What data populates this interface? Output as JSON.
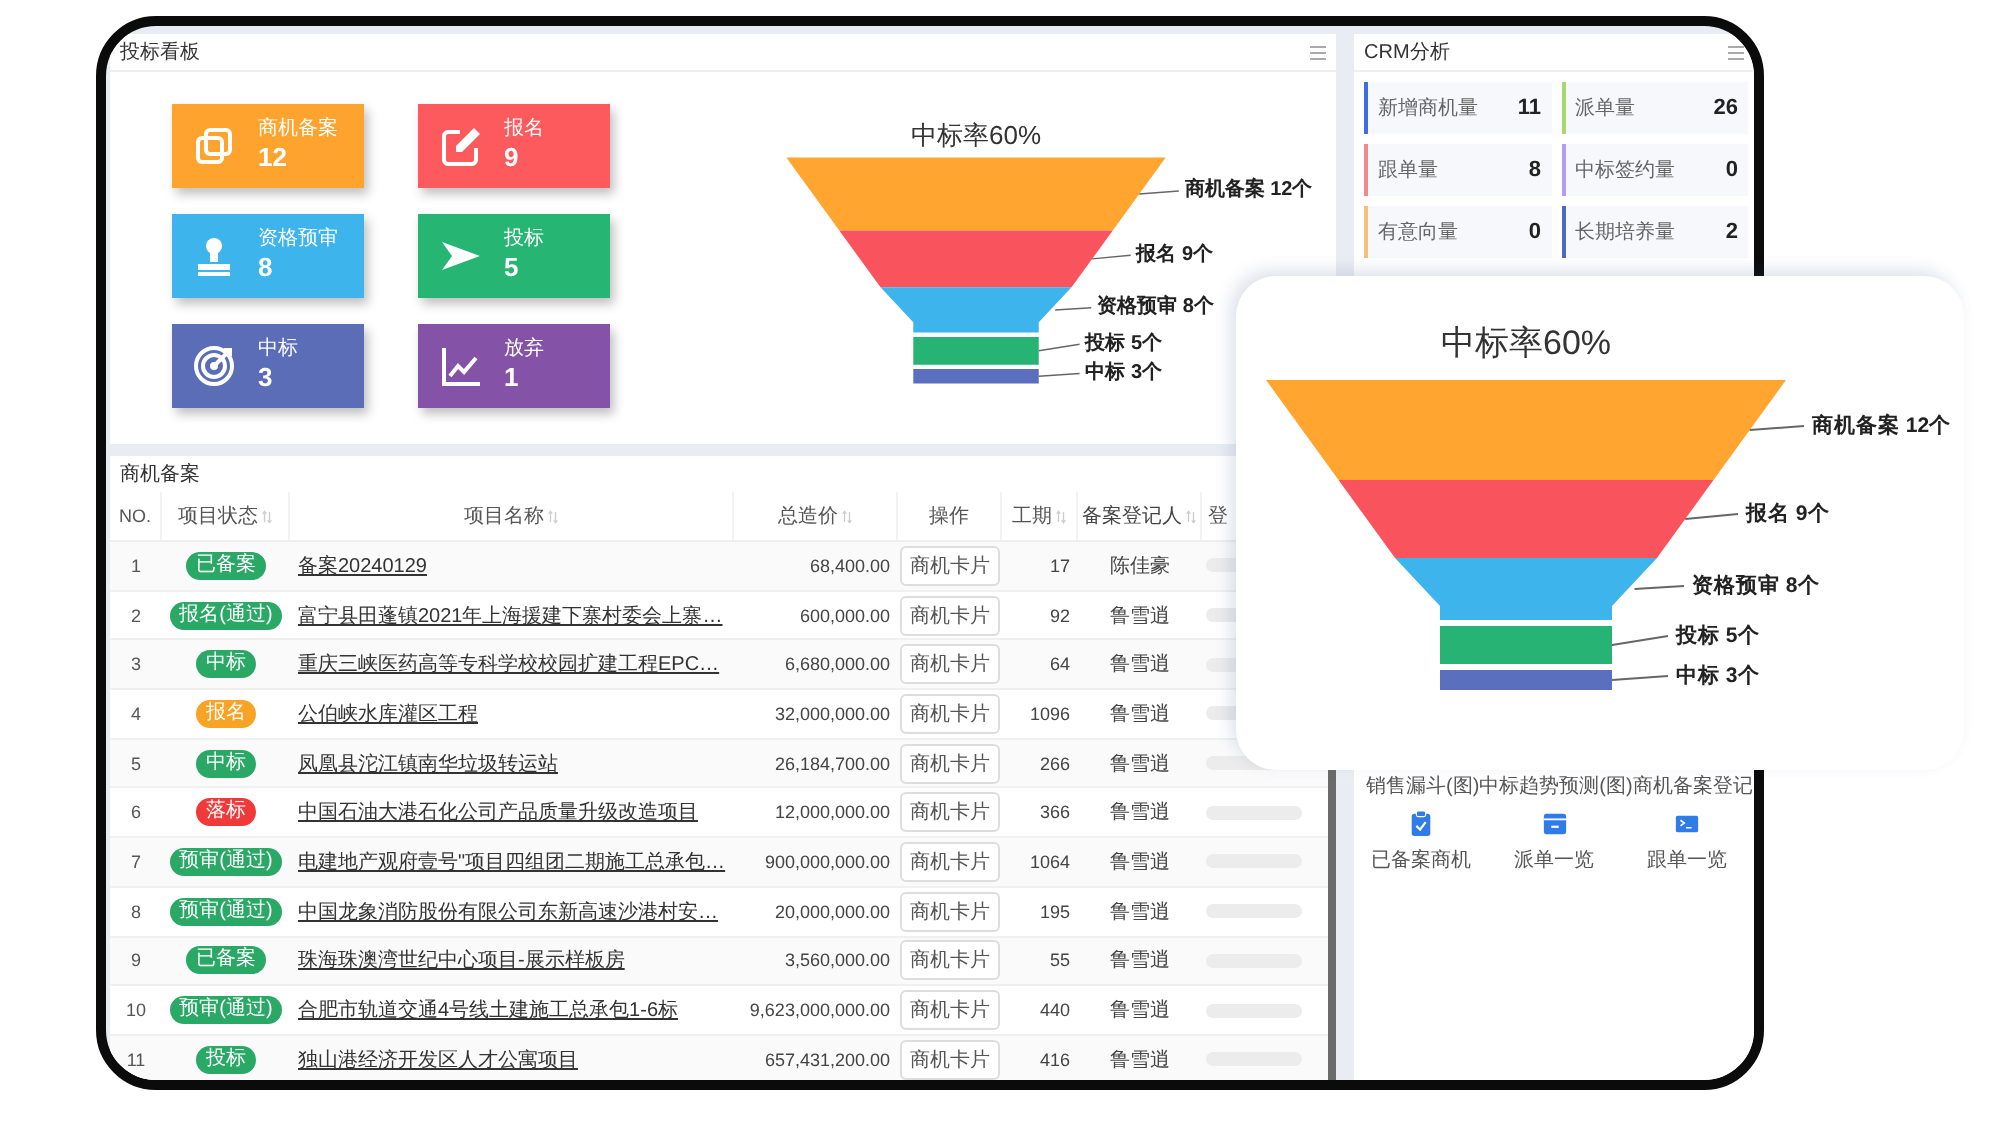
{
  "dashboard": {
    "title": "投标看板",
    "stats": [
      {
        "label": "商机备案",
        "value": "12",
        "color": "#fea42e"
      },
      {
        "label": "报名",
        "value": "9",
        "color": "#fc5a5d"
      },
      {
        "label": "资格预审",
        "value": "8",
        "color": "#3eb4ec"
      },
      {
        "label": "投标",
        "value": "5",
        "color": "#27b574"
      },
      {
        "label": "中标",
        "value": "3",
        "color": "#5a6db6"
      },
      {
        "label": "放弃",
        "value": "1",
        "color": "#8453a8"
      }
    ],
    "funnel": {
      "title": "中标率60%",
      "stages": [
        {
          "label": "商机备案 12个",
          "color": "#ffa530"
        },
        {
          "label": "报名 9个",
          "color": "#f9545e"
        },
        {
          "label": "资格预审 8个",
          "color": "#3db5ec"
        },
        {
          "label": "投标 5个",
          "color": "#27b373"
        },
        {
          "label": "中标 3个",
          "color": "#5b6fbf"
        }
      ]
    }
  },
  "table_panel": {
    "title": "商机备案",
    "columns": [
      {
        "label": "NO.",
        "sortable": false
      },
      {
        "label": "项目状态",
        "sortable": true
      },
      {
        "label": "项目名称",
        "sortable": true
      },
      {
        "label": "总造价",
        "sortable": true
      },
      {
        "label": "操作",
        "sortable": false
      },
      {
        "label": "工期",
        "sortable": true
      },
      {
        "label": "备案登记人",
        "sortable": true
      },
      {
        "label": "登",
        "sortable": false
      }
    ],
    "rows": [
      {
        "no": "1",
        "status": {
          "text": "已备案",
          "color": "#2aa866"
        },
        "name": "备案20240129",
        "price": "68,400.00",
        "action": "商机卡片",
        "duration": "17",
        "registrant": "陈佳豪"
      },
      {
        "no": "2",
        "status": {
          "text": "报名(通过)",
          "color": "#2aa866"
        },
        "name": "富宁县田蓬镇2021年上海援建下寨村委会上寨…",
        "price": "600,000.00",
        "action": "商机卡片",
        "duration": "92",
        "registrant": "鲁雪逍"
      },
      {
        "no": "3",
        "status": {
          "text": "中标",
          "color": "#2aa866"
        },
        "name": "重庆三峡医药高等专科学校校园扩建工程EPC…",
        "price": "6,680,000.00",
        "action": "商机卡片",
        "duration": "64",
        "registrant": "鲁雪逍"
      },
      {
        "no": "4",
        "status": {
          "text": "报名",
          "color": "#f7a325"
        },
        "name": "公伯峡水库灌区工程",
        "price": "32,000,000.00",
        "action": "商机卡片",
        "duration": "1096",
        "registrant": "鲁雪逍"
      },
      {
        "no": "5",
        "status": {
          "text": "中标",
          "color": "#2aa866"
        },
        "name": "凤凰县沱江镇南华垃圾转运站",
        "price": "26,184,700.00",
        "action": "商机卡片",
        "duration": "266",
        "registrant": "鲁雪逍"
      },
      {
        "no": "6",
        "status": {
          "text": "落标",
          "color": "#f03a3a"
        },
        "name": "中国石油大港石化公司产品质量升级改造项目",
        "price": "12,000,000.00",
        "action": "商机卡片",
        "duration": "366",
        "registrant": "鲁雪逍"
      },
      {
        "no": "7",
        "status": {
          "text": "预审(通过)",
          "color": "#2aa866"
        },
        "name": "电建地产观府壹号\"项目四组团二期施工总承包…",
        "price": "900,000,000.00",
        "action": "商机卡片",
        "duration": "1064",
        "registrant": "鲁雪逍"
      },
      {
        "no": "8",
        "status": {
          "text": "预审(通过)",
          "color": "#2aa866"
        },
        "name": "中国龙象消防股份有限公司东新高速沙港村安…",
        "price": "20,000,000.00",
        "action": "商机卡片",
        "duration": "195",
        "registrant": "鲁雪逍"
      },
      {
        "no": "9",
        "status": {
          "text": "已备案",
          "color": "#2aa866"
        },
        "name": "珠海珠澳湾世纪中心项目-展示样板房",
        "price": "3,560,000.00",
        "action": "商机卡片",
        "duration": "55",
        "registrant": "鲁雪逍"
      },
      {
        "no": "10",
        "status": {
          "text": "预审(通过)",
          "color": "#2aa866"
        },
        "name": "合肥市轨道交通4号线土建施工总承包1-6标",
        "price": "9,623,000,000.00",
        "action": "商机卡片",
        "duration": "440",
        "registrant": "鲁雪逍"
      },
      {
        "no": "11",
        "status": {
          "text": "投标",
          "color": "#2aa866"
        },
        "name": "独山港经济开发区人才公寓项目",
        "price": "657,431,200.00",
        "action": "商机卡片",
        "duration": "416",
        "registrant": "鲁雪逍"
      }
    ]
  },
  "crm": {
    "title": "CRM分析",
    "metrics": [
      {
        "label": "新增商机量",
        "value": "11",
        "color": "#3d6ee6"
      },
      {
        "label": "派单量",
        "value": "26",
        "color": "#a6d86e"
      },
      {
        "label": "跟单量",
        "value": "8",
        "color": "#f08a8a"
      },
      {
        "label": "中标签约量",
        "value": "0",
        "color": "#b39cf5"
      },
      {
        "label": "有意向量",
        "value": "0",
        "color": "#f5c07a"
      },
      {
        "label": "长期培养量",
        "value": "2",
        "color": "#5467c0"
      }
    ],
    "chart_links": [
      "销售漏斗(图)",
      "中标趋势预测(图)",
      "商机备案登记"
    ],
    "shortcuts": [
      "已备案商机",
      "派单一览",
      "跟单一览"
    ]
  },
  "overlay_card": {
    "funnel": {
      "title": "中标率60%",
      "stages": [
        {
          "label": "商机备案 12个",
          "color": "#ffa530"
        },
        {
          "label": "报名 9个",
          "color": "#f9545e"
        },
        {
          "label": "资格预审 8个",
          "color": "#3db5ec"
        },
        {
          "label": "投标 5个",
          "color": "#27b373"
        },
        {
          "label": "中标 3个",
          "color": "#5b6fbf"
        }
      ]
    }
  }
}
